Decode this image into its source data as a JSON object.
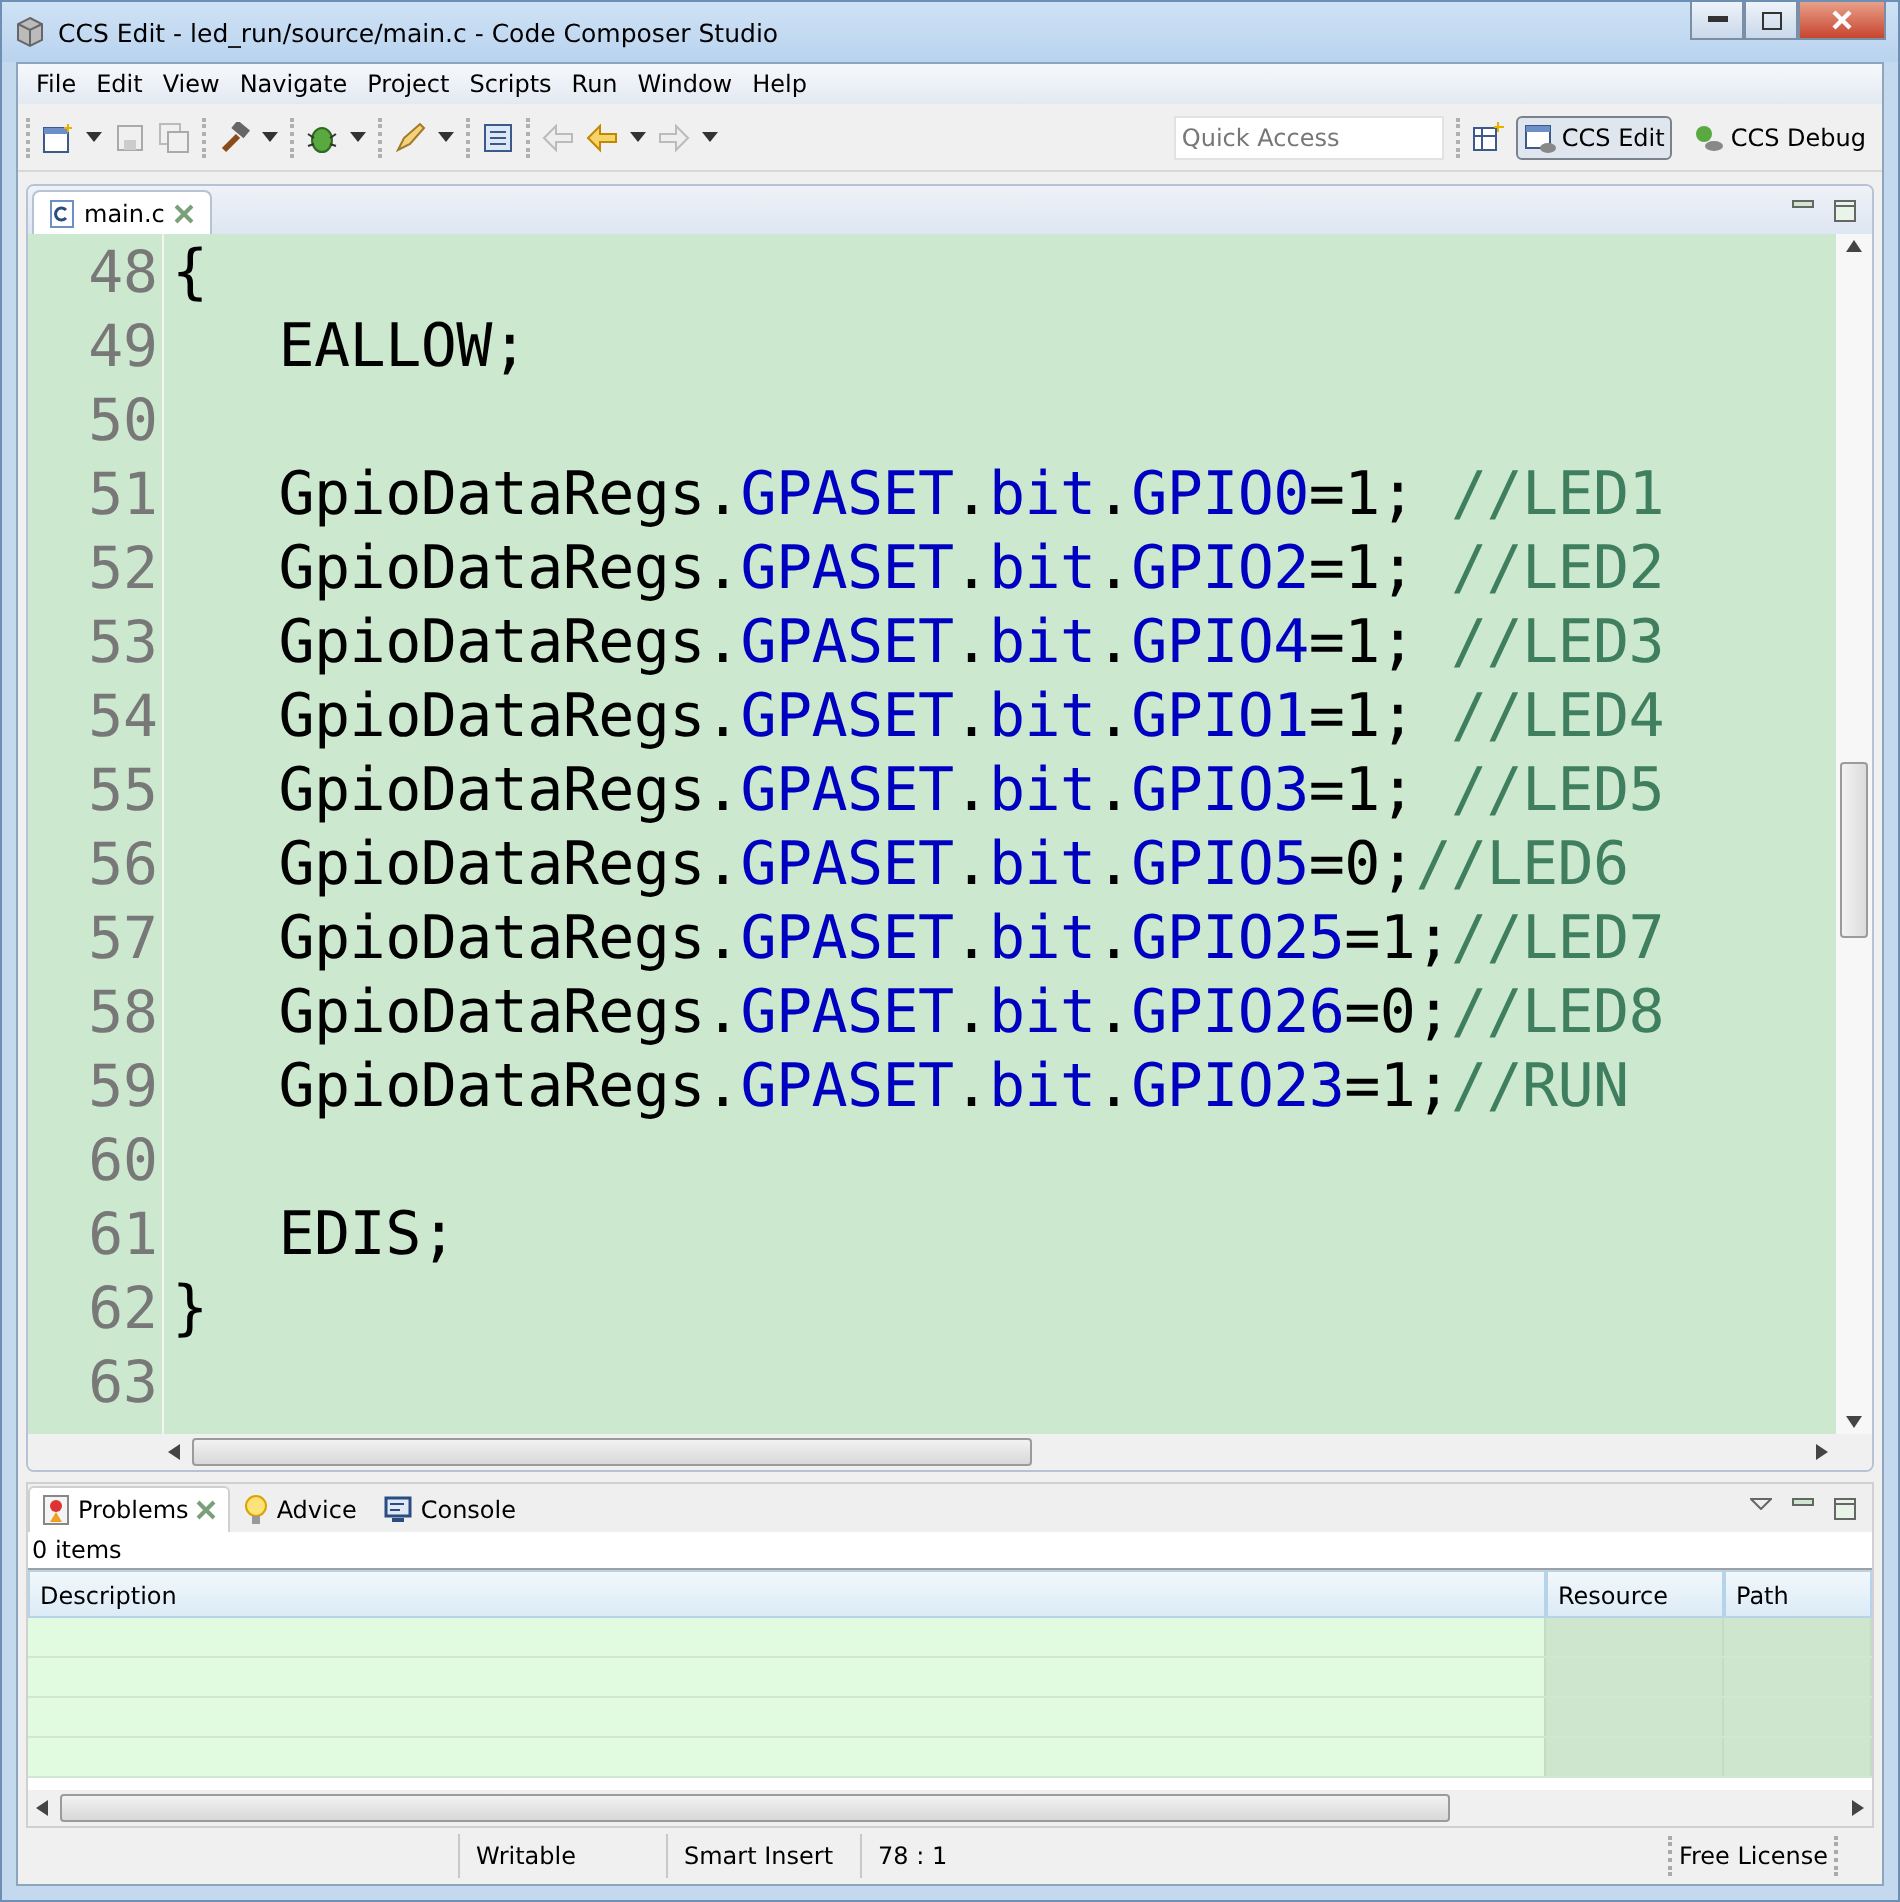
{
  "window": {
    "title": "CCS Edit - led_run/source/main.c - Code Composer Studio"
  },
  "menu": [
    "File",
    "Edit",
    "View",
    "Navigate",
    "Project",
    "Scripts",
    "Run",
    "Window",
    "Help"
  ],
  "quick_access": {
    "placeholder": "Quick Access"
  },
  "perspectives": [
    {
      "label": "CCS Edit",
      "selected": true
    },
    {
      "label": "CCS Debug",
      "selected": false
    }
  ],
  "editor": {
    "tab": "main.c",
    "lines": [
      {
        "number": "48",
        "segments": [
          {
            "kind": "plain",
            "text": "{"
          }
        ]
      },
      {
        "number": "49",
        "segments": [
          {
            "kind": "plain",
            "text": "   EALLOW;"
          }
        ]
      },
      {
        "number": "50"
      },
      {
        "number": "51",
        "segments": [
          {
            "kind": "plain",
            "text": "   GpioDataRegs."
          },
          {
            "kind": "field",
            "text": "GPASET"
          },
          {
            "kind": "plain",
            "text": "."
          },
          {
            "kind": "field",
            "text": "bit"
          },
          {
            "kind": "plain",
            "text": "."
          },
          {
            "kind": "field",
            "text": "GPIO0"
          },
          {
            "kind": "plain",
            "text": "=1; "
          },
          {
            "kind": "comment",
            "text": "//LED1"
          }
        ]
      },
      {
        "number": "52",
        "segments": [
          {
            "kind": "plain",
            "text": "   GpioDataRegs."
          },
          {
            "kind": "field",
            "text": "GPASET"
          },
          {
            "kind": "plain",
            "text": "."
          },
          {
            "kind": "field",
            "text": "bit"
          },
          {
            "kind": "plain",
            "text": "."
          },
          {
            "kind": "field",
            "text": "GPIO2"
          },
          {
            "kind": "plain",
            "text": "=1; "
          },
          {
            "kind": "comment",
            "text": "//LED2"
          }
        ]
      },
      {
        "number": "53",
        "segments": [
          {
            "kind": "plain",
            "text": "   GpioDataRegs."
          },
          {
            "kind": "field",
            "text": "GPASET"
          },
          {
            "kind": "plain",
            "text": "."
          },
          {
            "kind": "field",
            "text": "bit"
          },
          {
            "kind": "plain",
            "text": "."
          },
          {
            "kind": "field",
            "text": "GPIO4"
          },
          {
            "kind": "plain",
            "text": "=1; "
          },
          {
            "kind": "comment",
            "text": "//LED3"
          }
        ]
      },
      {
        "number": "54",
        "segments": [
          {
            "kind": "plain",
            "text": "   GpioDataRegs."
          },
          {
            "kind": "field",
            "text": "GPASET"
          },
          {
            "kind": "plain",
            "text": "."
          },
          {
            "kind": "field",
            "text": "bit"
          },
          {
            "kind": "plain",
            "text": "."
          },
          {
            "kind": "field",
            "text": "GPIO1"
          },
          {
            "kind": "plain",
            "text": "=1; "
          },
          {
            "kind": "comment",
            "text": "//LED4"
          }
        ]
      },
      {
        "number": "55",
        "segments": [
          {
            "kind": "plain",
            "text": "   GpioDataRegs."
          },
          {
            "kind": "field",
            "text": "GPASET"
          },
          {
            "kind": "plain",
            "text": "."
          },
          {
            "kind": "field",
            "text": "bit"
          },
          {
            "kind": "plain",
            "text": "."
          },
          {
            "kind": "field",
            "text": "GPIO3"
          },
          {
            "kind": "plain",
            "text": "=1; "
          },
          {
            "kind": "comment",
            "text": "//LED5"
          }
        ]
      },
      {
        "number": "56",
        "segments": [
          {
            "kind": "plain",
            "text": "   GpioDataRegs."
          },
          {
            "kind": "field",
            "text": "GPASET"
          },
          {
            "kind": "plain",
            "text": "."
          },
          {
            "kind": "field",
            "text": "bit"
          },
          {
            "kind": "plain",
            "text": "."
          },
          {
            "kind": "field",
            "text": "GPIO5"
          },
          {
            "kind": "plain",
            "text": "=0;"
          },
          {
            "kind": "comment",
            "text": "//LED6"
          }
        ]
      },
      {
        "number": "57",
        "segments": [
          {
            "kind": "plain",
            "text": "   GpioDataRegs."
          },
          {
            "kind": "field",
            "text": "GPASET"
          },
          {
            "kind": "plain",
            "text": "."
          },
          {
            "kind": "field",
            "text": "bit"
          },
          {
            "kind": "plain",
            "text": "."
          },
          {
            "kind": "field",
            "text": "GPIO25"
          },
          {
            "kind": "plain",
            "text": "=1;"
          },
          {
            "kind": "comment",
            "text": "//LED7"
          }
        ]
      },
      {
        "number": "58",
        "segments": [
          {
            "kind": "plain",
            "text": "   GpioDataRegs."
          },
          {
            "kind": "field",
            "text": "GPASET"
          },
          {
            "kind": "plain",
            "text": "."
          },
          {
            "kind": "field",
            "text": "bit"
          },
          {
            "kind": "plain",
            "text": "."
          },
          {
            "kind": "field",
            "text": "GPIO26"
          },
          {
            "kind": "plain",
            "text": "=0;"
          },
          {
            "kind": "comment",
            "text": "//LED8"
          }
        ]
      },
      {
        "number": "59",
        "segments": [
          {
            "kind": "plain",
            "text": "   GpioDataRegs."
          },
          {
            "kind": "field",
            "text": "GPASET"
          },
          {
            "kind": "plain",
            "text": "."
          },
          {
            "kind": "field",
            "text": "bit"
          },
          {
            "kind": "plain",
            "text": "."
          },
          {
            "kind": "field",
            "text": "GPIO23"
          },
          {
            "kind": "plain",
            "text": "=1;"
          },
          {
            "kind": "comment",
            "text": "//RUN"
          }
        ]
      },
      {
        "number": "60"
      },
      {
        "number": "61",
        "segments": [
          {
            "kind": "plain",
            "text": "   EDIS;"
          }
        ]
      },
      {
        "number": "62",
        "segments": [
          {
            "kind": "plain",
            "text": "}"
          }
        ]
      },
      {
        "number": "63"
      }
    ]
  },
  "bottom_panel": {
    "tabs": [
      {
        "label": "Problems",
        "selected": true
      },
      {
        "label": "Advice",
        "selected": false
      },
      {
        "label": "Console",
        "selected": false
      }
    ],
    "summary": "0 items",
    "columns": [
      "Description",
      "Resource",
      "Path"
    ]
  },
  "status_bar": [
    "Writable",
    "Smart Insert",
    "78 : 1",
    "Free License"
  ]
}
